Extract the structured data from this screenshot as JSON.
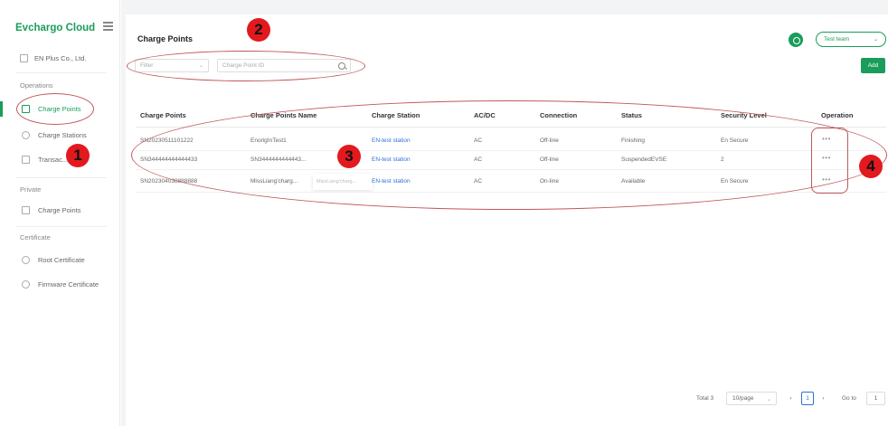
{
  "app": {
    "logo": "Evchargo Cloud",
    "organization": "EN Plus Co., Ltd."
  },
  "sidebar": {
    "groups": [
      {
        "label": "Operations",
        "items": [
          {
            "label": "Charge Points"
          },
          {
            "label": "Charge Stations"
          },
          {
            "label": "Transac..."
          }
        ]
      },
      {
        "label": "Private",
        "items": [
          {
            "label": "Charge Points"
          }
        ]
      },
      {
        "label": "Certificate",
        "items": [
          {
            "label": "Root Certificate"
          },
          {
            "label": "Firmware Certificate"
          }
        ]
      }
    ]
  },
  "header": {
    "title": "Charge Points",
    "filter_placeholder": "Filter",
    "search_placeholder": "Charge Point ID",
    "team_label": "Test team",
    "add_label": "Add"
  },
  "table": {
    "columns": [
      "Charge Points",
      "Charge Points Name",
      "Charge Station",
      "AC/DC",
      "Connection",
      "Status",
      "Security Level",
      "Operation"
    ],
    "rows": [
      {
        "id": "SN20230511101222",
        "name": "EnorigInTest1",
        "station": "EN-test station",
        "acdc": "AC",
        "connection": "Off-line",
        "status": "Finishing",
        "security": "En Secure",
        "op": "•••"
      },
      {
        "id": "SN344444444444433",
        "name": "SN3444444444443...",
        "station": "EN-test station",
        "acdc": "AC",
        "connection": "Off-line",
        "status": "SuspendedEVSE",
        "security": "2",
        "op": "•••"
      },
      {
        "id": "SN202304038888888",
        "name": "MissLiang'charg...",
        "station": "EN-test station",
        "acdc": "AC",
        "connection": "On-line",
        "status": "Available",
        "security": "En Secure",
        "op": "•••"
      }
    ],
    "tooltip": "MissLiang'charg..."
  },
  "pagination": {
    "total": "Total 3",
    "page_size": "10/page",
    "prev": "‹",
    "current": "1",
    "next": "›",
    "goto_label": "Go to",
    "goto_value": "1"
  },
  "annotations": [
    "1",
    "2",
    "3",
    "4"
  ],
  "colors": {
    "accent": "#1a9c5a",
    "link": "#2f6fd8",
    "annotation": "#e2191e"
  }
}
